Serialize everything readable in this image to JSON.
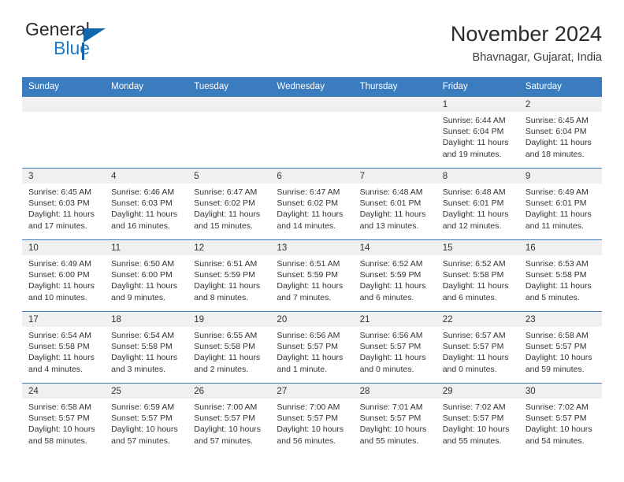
{
  "logo": {
    "word1": "General",
    "word2": "Blue",
    "triangle_color": "#1266ac",
    "blue_color": "#1f7ac4"
  },
  "header": {
    "title": "November 2024",
    "subtitle": "Bhavnagar, Gujarat, India",
    "header_bg": "#3a7cbe"
  },
  "weekday_headers": [
    "Sunday",
    "Monday",
    "Tuesday",
    "Wednesday",
    "Thursday",
    "Friday",
    "Saturday"
  ],
  "weeks": [
    [
      {
        "day": "",
        "blank": true
      },
      {
        "day": "",
        "blank": true
      },
      {
        "day": "",
        "blank": true
      },
      {
        "day": "",
        "blank": true
      },
      {
        "day": "",
        "blank": true
      },
      {
        "day": "1",
        "sunrise": "Sunrise: 6:44 AM",
        "sunset": "Sunset: 6:04 PM",
        "daylight1": "Daylight: 11 hours",
        "daylight2": "and 19 minutes."
      },
      {
        "day": "2",
        "sunrise": "Sunrise: 6:45 AM",
        "sunset": "Sunset: 6:04 PM",
        "daylight1": "Daylight: 11 hours",
        "daylight2": "and 18 minutes."
      }
    ],
    [
      {
        "day": "3",
        "sunrise": "Sunrise: 6:45 AM",
        "sunset": "Sunset: 6:03 PM",
        "daylight1": "Daylight: 11 hours",
        "daylight2": "and 17 minutes."
      },
      {
        "day": "4",
        "sunrise": "Sunrise: 6:46 AM",
        "sunset": "Sunset: 6:03 PM",
        "daylight1": "Daylight: 11 hours",
        "daylight2": "and 16 minutes."
      },
      {
        "day": "5",
        "sunrise": "Sunrise: 6:47 AM",
        "sunset": "Sunset: 6:02 PM",
        "daylight1": "Daylight: 11 hours",
        "daylight2": "and 15 minutes."
      },
      {
        "day": "6",
        "sunrise": "Sunrise: 6:47 AM",
        "sunset": "Sunset: 6:02 PM",
        "daylight1": "Daylight: 11 hours",
        "daylight2": "and 14 minutes."
      },
      {
        "day": "7",
        "sunrise": "Sunrise: 6:48 AM",
        "sunset": "Sunset: 6:01 PM",
        "daylight1": "Daylight: 11 hours",
        "daylight2": "and 13 minutes."
      },
      {
        "day": "8",
        "sunrise": "Sunrise: 6:48 AM",
        "sunset": "Sunset: 6:01 PM",
        "daylight1": "Daylight: 11 hours",
        "daylight2": "and 12 minutes."
      },
      {
        "day": "9",
        "sunrise": "Sunrise: 6:49 AM",
        "sunset": "Sunset: 6:01 PM",
        "daylight1": "Daylight: 11 hours",
        "daylight2": "and 11 minutes."
      }
    ],
    [
      {
        "day": "10",
        "sunrise": "Sunrise: 6:49 AM",
        "sunset": "Sunset: 6:00 PM",
        "daylight1": "Daylight: 11 hours",
        "daylight2": "and 10 minutes."
      },
      {
        "day": "11",
        "sunrise": "Sunrise: 6:50 AM",
        "sunset": "Sunset: 6:00 PM",
        "daylight1": "Daylight: 11 hours",
        "daylight2": "and 9 minutes."
      },
      {
        "day": "12",
        "sunrise": "Sunrise: 6:51 AM",
        "sunset": "Sunset: 5:59 PM",
        "daylight1": "Daylight: 11 hours",
        "daylight2": "and 8 minutes."
      },
      {
        "day": "13",
        "sunrise": "Sunrise: 6:51 AM",
        "sunset": "Sunset: 5:59 PM",
        "daylight1": "Daylight: 11 hours",
        "daylight2": "and 7 minutes."
      },
      {
        "day": "14",
        "sunrise": "Sunrise: 6:52 AM",
        "sunset": "Sunset: 5:59 PM",
        "daylight1": "Daylight: 11 hours",
        "daylight2": "and 6 minutes."
      },
      {
        "day": "15",
        "sunrise": "Sunrise: 6:52 AM",
        "sunset": "Sunset: 5:58 PM",
        "daylight1": "Daylight: 11 hours",
        "daylight2": "and 6 minutes."
      },
      {
        "day": "16",
        "sunrise": "Sunrise: 6:53 AM",
        "sunset": "Sunset: 5:58 PM",
        "daylight1": "Daylight: 11 hours",
        "daylight2": "and 5 minutes."
      }
    ],
    [
      {
        "day": "17",
        "sunrise": "Sunrise: 6:54 AM",
        "sunset": "Sunset: 5:58 PM",
        "daylight1": "Daylight: 11 hours",
        "daylight2": "and 4 minutes."
      },
      {
        "day": "18",
        "sunrise": "Sunrise: 6:54 AM",
        "sunset": "Sunset: 5:58 PM",
        "daylight1": "Daylight: 11 hours",
        "daylight2": "and 3 minutes."
      },
      {
        "day": "19",
        "sunrise": "Sunrise: 6:55 AM",
        "sunset": "Sunset: 5:58 PM",
        "daylight1": "Daylight: 11 hours",
        "daylight2": "and 2 minutes."
      },
      {
        "day": "20",
        "sunrise": "Sunrise: 6:56 AM",
        "sunset": "Sunset: 5:57 PM",
        "daylight1": "Daylight: 11 hours",
        "daylight2": "and 1 minute."
      },
      {
        "day": "21",
        "sunrise": "Sunrise: 6:56 AM",
        "sunset": "Sunset: 5:57 PM",
        "daylight1": "Daylight: 11 hours",
        "daylight2": "and 0 minutes."
      },
      {
        "day": "22",
        "sunrise": "Sunrise: 6:57 AM",
        "sunset": "Sunset: 5:57 PM",
        "daylight1": "Daylight: 11 hours",
        "daylight2": "and 0 minutes."
      },
      {
        "day": "23",
        "sunrise": "Sunrise: 6:58 AM",
        "sunset": "Sunset: 5:57 PM",
        "daylight1": "Daylight: 10 hours",
        "daylight2": "and 59 minutes."
      }
    ],
    [
      {
        "day": "24",
        "sunrise": "Sunrise: 6:58 AM",
        "sunset": "Sunset: 5:57 PM",
        "daylight1": "Daylight: 10 hours",
        "daylight2": "and 58 minutes."
      },
      {
        "day": "25",
        "sunrise": "Sunrise: 6:59 AM",
        "sunset": "Sunset: 5:57 PM",
        "daylight1": "Daylight: 10 hours",
        "daylight2": "and 57 minutes."
      },
      {
        "day": "26",
        "sunrise": "Sunrise: 7:00 AM",
        "sunset": "Sunset: 5:57 PM",
        "daylight1": "Daylight: 10 hours",
        "daylight2": "and 57 minutes."
      },
      {
        "day": "27",
        "sunrise": "Sunrise: 7:00 AM",
        "sunset": "Sunset: 5:57 PM",
        "daylight1": "Daylight: 10 hours",
        "daylight2": "and 56 minutes."
      },
      {
        "day": "28",
        "sunrise": "Sunrise: 7:01 AM",
        "sunset": "Sunset: 5:57 PM",
        "daylight1": "Daylight: 10 hours",
        "daylight2": "and 55 minutes."
      },
      {
        "day": "29",
        "sunrise": "Sunrise: 7:02 AM",
        "sunset": "Sunset: 5:57 PM",
        "daylight1": "Daylight: 10 hours",
        "daylight2": "and 55 minutes."
      },
      {
        "day": "30",
        "sunrise": "Sunrise: 7:02 AM",
        "sunset": "Sunset: 5:57 PM",
        "daylight1": "Daylight: 10 hours",
        "daylight2": "and 54 minutes."
      }
    ]
  ]
}
